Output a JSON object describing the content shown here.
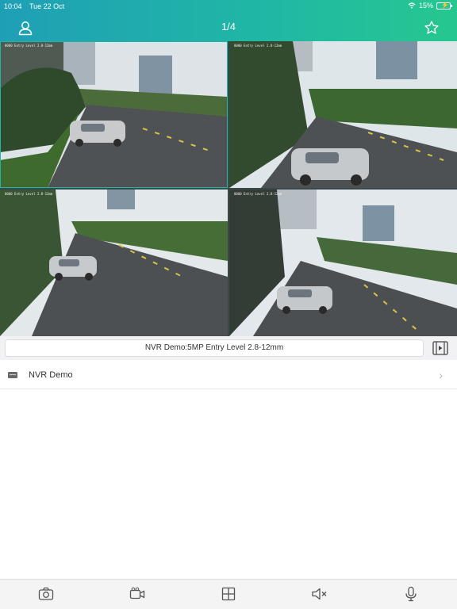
{
  "status_bar": {
    "time": "10:04",
    "date": "Tue 22 Oct",
    "battery": "15%"
  },
  "nav": {
    "page_indicator": "1/4",
    "left_icon": "user-icon",
    "right_icon": "star-icon"
  },
  "cameras": [
    {
      "osd": "0000 Entry Level 2.8-12mm",
      "active": true
    },
    {
      "osd": "0000 Entry Level 2.8-12mm",
      "active": false
    },
    {
      "osd": "0000 Entry Level 2.8-12mm",
      "active": false
    },
    {
      "osd": "0000 Entry Level 2.8-12mm",
      "active": false
    }
  ],
  "channel": {
    "label": "NVR Demo:5MP Entry Level 2.8-12mm",
    "playback_icon": "film-icon"
  },
  "devices": [
    {
      "name": "NVR Demo",
      "icon": "nvr-icon"
    }
  ],
  "toolbar": {
    "items": [
      "camera-icon",
      "video-record-icon",
      "grid-layout-icon",
      "mute-icon",
      "microphone-icon"
    ]
  },
  "colors": {
    "header_start": "#1f9fb6",
    "header_end": "#26c78f",
    "accent": "#20b6a6"
  }
}
